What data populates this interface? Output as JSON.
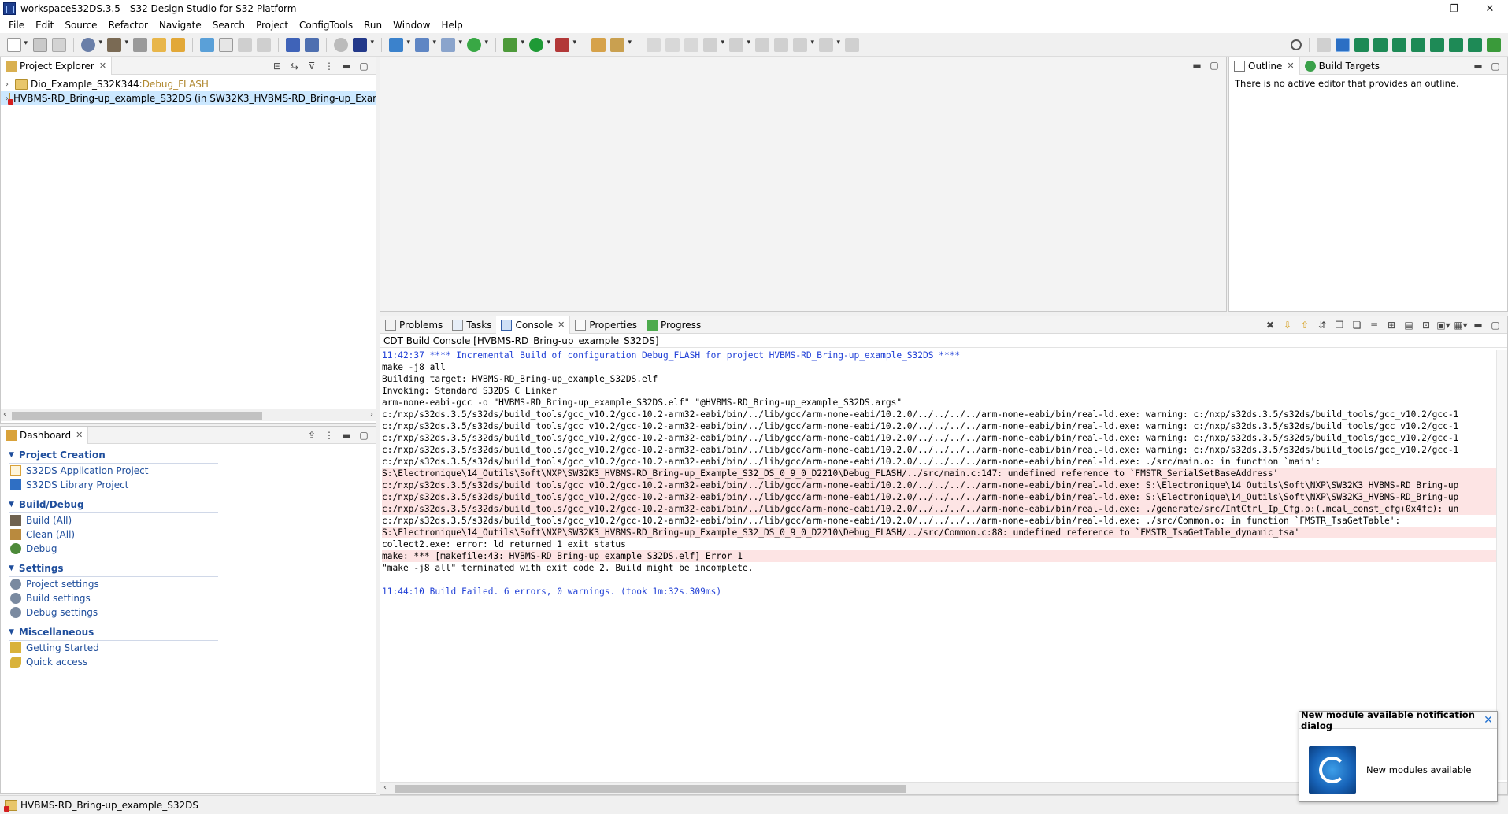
{
  "window": {
    "title": "workspaceS32DS.3.5 - S32 Design Studio for S32 Platform",
    "minimize": "—",
    "maximize": "❐",
    "close": "✕"
  },
  "menu": [
    "File",
    "Edit",
    "Source",
    "Refactor",
    "Navigate",
    "Search",
    "Project",
    "ConfigTools",
    "Run",
    "Window",
    "Help"
  ],
  "project_explorer": {
    "tab_label": "Project Explorer",
    "items": [
      {
        "name": "Dio_Example_S32K344:",
        "config": " Debug_FLASH"
      },
      {
        "name": "HVBMS-RD_Bring-up_example_S32DS (in SW32K3_HVBMS-RD_Bring-up_Example_S",
        "config": ""
      }
    ]
  },
  "dashboard": {
    "tab_label": "Dashboard",
    "sections": [
      {
        "title": "Project Creation",
        "items": [
          "S32DS Application Project",
          "S32DS Library Project"
        ]
      },
      {
        "title": "Build/Debug",
        "items": [
          "Build  (All)",
          "Clean  (All)",
          "Debug"
        ]
      },
      {
        "title": "Settings",
        "items": [
          "Project settings",
          "Build settings",
          "Debug settings"
        ]
      },
      {
        "title": "Miscellaneous",
        "items": [
          "Getting Started",
          "Quick access"
        ]
      }
    ]
  },
  "outline": {
    "tabs": [
      "Outline",
      "Build Targets"
    ],
    "message": "There is no active editor that provides an outline."
  },
  "bottom_tabs": [
    "Problems",
    "Tasks",
    "Console",
    "Properties",
    "Progress"
  ],
  "console": {
    "title": "CDT Build Console [HVBMS-RD_Bring-up_example_S32DS]",
    "lines": [
      {
        "text": "11:42:37 **** Incremental Build of configuration Debug_FLASH for project HVBMS-RD_Bring-up_example_S32DS ****",
        "kind": "info"
      },
      {
        "text": "make -j8 all",
        "kind": "normal"
      },
      {
        "text": "Building target: HVBMS-RD_Bring-up_example_S32DS.elf",
        "kind": "normal"
      },
      {
        "text": "Invoking: Standard S32DS C Linker",
        "kind": "normal"
      },
      {
        "text": "arm-none-eabi-gcc -o \"HVBMS-RD_Bring-up_example_S32DS.elf\" \"@HVBMS-RD_Bring-up_example_S32DS.args\"",
        "kind": "normal"
      },
      {
        "text": "c:/nxp/s32ds.3.5/s32ds/build_tools/gcc_v10.2/gcc-10.2-arm32-eabi/bin/../lib/gcc/arm-none-eabi/10.2.0/../../../../arm-none-eabi/bin/real-ld.exe: warning: c:/nxp/s32ds.3.5/s32ds/build_tools/gcc_v10.2/gcc-1",
        "kind": "normal"
      },
      {
        "text": "c:/nxp/s32ds.3.5/s32ds/build_tools/gcc_v10.2/gcc-10.2-arm32-eabi/bin/../lib/gcc/arm-none-eabi/10.2.0/../../../../arm-none-eabi/bin/real-ld.exe: warning: c:/nxp/s32ds.3.5/s32ds/build_tools/gcc_v10.2/gcc-1",
        "kind": "normal"
      },
      {
        "text": "c:/nxp/s32ds.3.5/s32ds/build_tools/gcc_v10.2/gcc-10.2-arm32-eabi/bin/../lib/gcc/arm-none-eabi/10.2.0/../../../../arm-none-eabi/bin/real-ld.exe: warning: c:/nxp/s32ds.3.5/s32ds/build_tools/gcc_v10.2/gcc-1",
        "kind": "normal"
      },
      {
        "text": "c:/nxp/s32ds.3.5/s32ds/build_tools/gcc_v10.2/gcc-10.2-arm32-eabi/bin/../lib/gcc/arm-none-eabi/10.2.0/../../../../arm-none-eabi/bin/real-ld.exe: warning: c:/nxp/s32ds.3.5/s32ds/build_tools/gcc_v10.2/gcc-1",
        "kind": "normal"
      },
      {
        "text": "c:/nxp/s32ds.3.5/s32ds/build_tools/gcc_v10.2/gcc-10.2-arm32-eabi/bin/../lib/gcc/arm-none-eabi/10.2.0/../../../../arm-none-eabi/bin/real-ld.exe: ./src/main.o: in function `main':",
        "kind": "normal"
      },
      {
        "text": "S:\\Electronique\\14_Outils\\Soft\\NXP\\SW32K3_HVBMS-RD_Bring-up_Example_S32_DS_0_9_0_D2210\\Debug_FLASH/../src/main.c:147: undefined reference to `FMSTR_SerialSetBaseAddress'",
        "kind": "err"
      },
      {
        "text": "c:/nxp/s32ds.3.5/s32ds/build_tools/gcc_v10.2/gcc-10.2-arm32-eabi/bin/../lib/gcc/arm-none-eabi/10.2.0/../../../../arm-none-eabi/bin/real-ld.exe: S:\\Electronique\\14_Outils\\Soft\\NXP\\SW32K3_HVBMS-RD_Bring-up",
        "kind": "err"
      },
      {
        "text": "c:/nxp/s32ds.3.5/s32ds/build_tools/gcc_v10.2/gcc-10.2-arm32-eabi/bin/../lib/gcc/arm-none-eabi/10.2.0/../../../../arm-none-eabi/bin/real-ld.exe: S:\\Electronique\\14_Outils\\Soft\\NXP\\SW32K3_HVBMS-RD_Bring-up",
        "kind": "err"
      },
      {
        "text": "c:/nxp/s32ds.3.5/s32ds/build_tools/gcc_v10.2/gcc-10.2-arm32-eabi/bin/../lib/gcc/arm-none-eabi/10.2.0/../../../../arm-none-eabi/bin/real-ld.exe: ./generate/src/IntCtrl_Ip_Cfg.o:(.mcal_const_cfg+0x4fc): un",
        "kind": "err"
      },
      {
        "text": "c:/nxp/s32ds.3.5/s32ds/build_tools/gcc_v10.2/gcc-10.2-arm32-eabi/bin/../lib/gcc/arm-none-eabi/10.2.0/../../../../arm-none-eabi/bin/real-ld.exe: ./src/Common.o: in function `FMSTR_TsaGetTable':",
        "kind": "normal"
      },
      {
        "text": "S:\\Electronique\\14_Outils\\Soft\\NXP\\SW32K3_HVBMS-RD_Bring-up_Example_S32_DS_0_9_0_D2210\\Debug_FLASH/../src/Common.c:88: undefined reference to `FMSTR_TsaGetTable_dynamic_tsa'",
        "kind": "err"
      },
      {
        "text": "collect2.exe: error: ld returned 1 exit status",
        "kind": "normal"
      },
      {
        "text": "make: *** [makefile:43: HVBMS-RD_Bring-up_example_S32DS.elf] Error 1",
        "kind": "err"
      },
      {
        "text": "\"make -j8 all\" terminated with exit code 2. Build might be incomplete.",
        "kind": "normal"
      },
      {
        "text": "",
        "kind": "normal"
      },
      {
        "text": "11:44:10 Build Failed. 6 errors, 0 warnings. (took 1m:32s.309ms)",
        "kind": "info"
      }
    ]
  },
  "status_bar": {
    "text": "HVBMS-RD_Bring-up_example_S32DS"
  },
  "notification": {
    "title": "New module available notification dialog",
    "message": "New modules available",
    "close": "✕"
  },
  "colors": {
    "link": "#1f4e9c",
    "console_info": "#1f3fd6",
    "console_error_bg": "#fde4e4",
    "selection": "#cce8ff"
  }
}
